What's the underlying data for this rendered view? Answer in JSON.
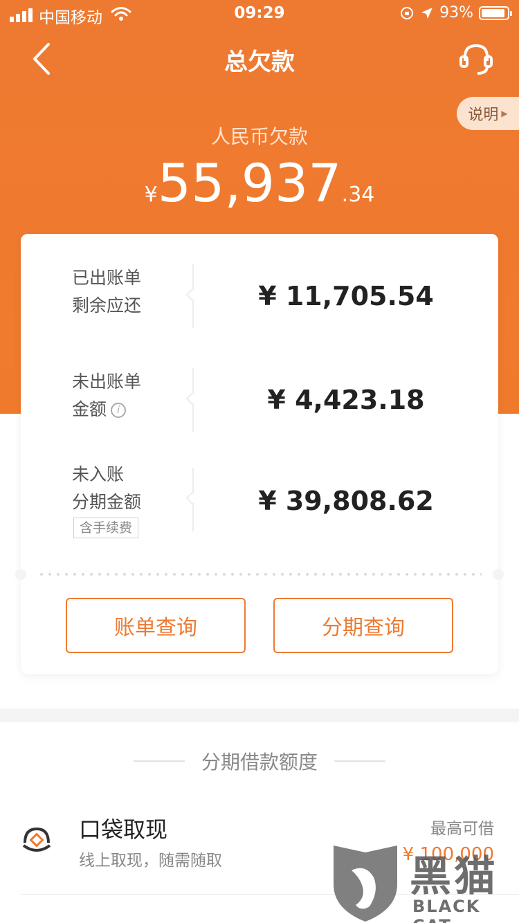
{
  "status_bar": {
    "carrier": "中国移动",
    "time": "09:29",
    "battery_percent": "93%",
    "battery_level": 0.93
  },
  "nav": {
    "title": "总欠款",
    "explain_label": "说明"
  },
  "summary": {
    "label": "人民币欠款",
    "currency_symbol": "¥",
    "amount_main": "55,937",
    "amount_cents": ".34"
  },
  "rows": [
    {
      "label_line1": "已出账单",
      "label_line2": "剩余应还",
      "value": "¥ 11,705.54"
    },
    {
      "label_line1": "未出账单",
      "label_line2": "金额",
      "value": "¥ 4,423.18"
    },
    {
      "label_line1": "未入账",
      "label_line2": "分期金额",
      "tag": "含手续费",
      "value": "¥ 39,808.62"
    }
  ],
  "actions": {
    "bill_query": "账单查询",
    "installment_query": "分期查询"
  },
  "loan": {
    "section_title": "分期借款额度",
    "product_name": "口袋取现",
    "product_desc": "线上取现，随需随取",
    "max_label": "最高可借",
    "max_value": "¥ 100,000"
  },
  "watermark": {
    "cn": "黑猫",
    "en": "BLACK CAT"
  },
  "colors": {
    "brand": "#ee7a32",
    "background": "#f4f4f4"
  }
}
